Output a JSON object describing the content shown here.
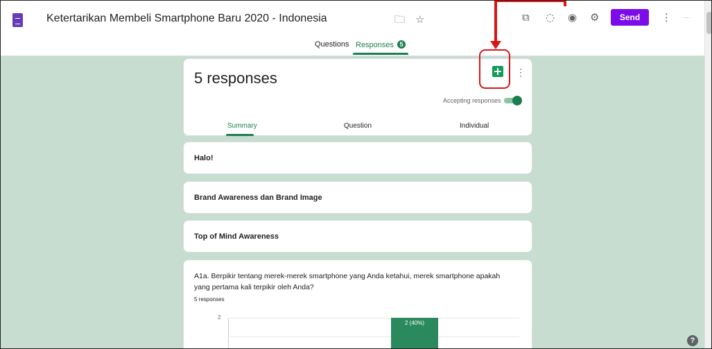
{
  "header": {
    "title": "Ketertarikan Membeli Smartphone Baru 2020 - Indonesia",
    "send_label": "Send",
    "user_text": "......",
    "icons": [
      "forms-logo",
      "folder-icon",
      "star-icon",
      "addon-icon",
      "palette-icon",
      "eye-icon",
      "settings-icon",
      "more-vert-icon"
    ],
    "accent": "#7b0be8"
  },
  "tabs": {
    "questions": "Questions",
    "responses": "Responses",
    "responses_count": "5",
    "active": "responses"
  },
  "responses_card": {
    "title": "5 responses",
    "accepting_label": "Accepting responses",
    "accepting": true,
    "subtabs": [
      "Summary",
      "Question",
      "Individual"
    ],
    "active_subtab": "Summary",
    "accent": "#1e7d4e"
  },
  "sections": [
    "Halo!",
    "Brand Awareness dan Brand Image",
    "Top of Mind Awareness"
  ],
  "question": {
    "text": "A1a. Berpikir tentang merek-merek smartphone yang Anda ketahui, merek smartphone apakah yang pertama kali terpikir oleh Anda?",
    "count": "5 responses"
  },
  "chart_data": {
    "type": "bar",
    "orientation": "vertical",
    "visible_axis_ticks": [
      "2"
    ],
    "series": [
      {
        "values": [
          2
        ],
        "labels": [
          "2 (40%)"
        ]
      }
    ],
    "color": "#2a8a5e",
    "grid": true
  },
  "help_label": "?"
}
